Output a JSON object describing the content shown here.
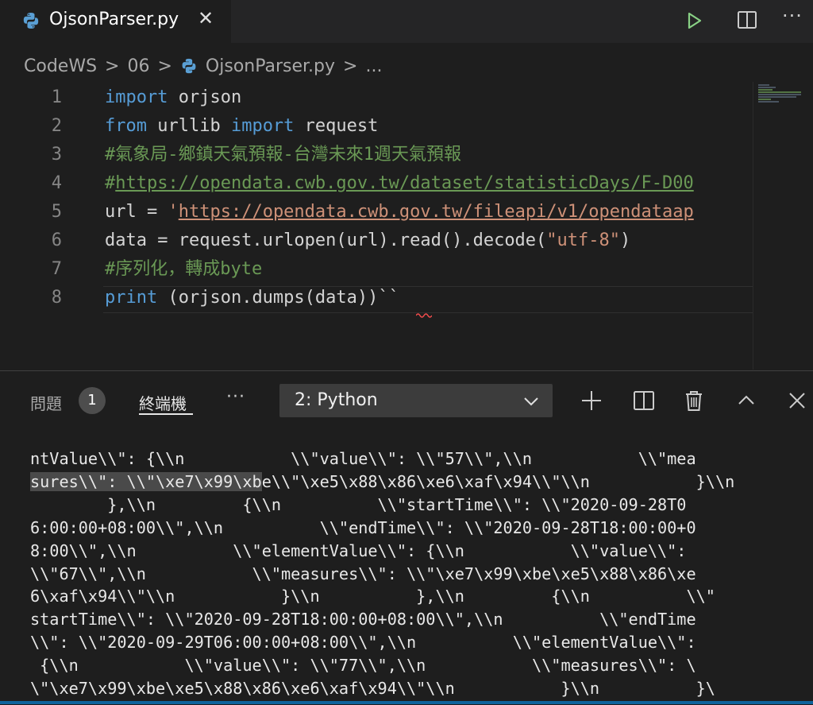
{
  "tab": {
    "title": "OjsonParser.py",
    "close_glyph": "✕",
    "icon": "python-icon"
  },
  "editor_actions": {
    "run_icon": "run-icon",
    "split_icon": "split-editor-icon",
    "more_label": "···"
  },
  "breadcrumb": {
    "items": [
      "CodeWS",
      "06",
      "OjsonParser.py",
      "..."
    ],
    "separator": ">"
  },
  "editor": {
    "line_numbers": [
      "1",
      "2",
      "3",
      "4",
      "5",
      "6",
      "7",
      "8"
    ],
    "lines": {
      "l1": {
        "kw": "import",
        "rest": " orjson"
      },
      "l2": {
        "kw1": "from",
        "mid": " urllib ",
        "kw2": "import",
        "rest": " request"
      },
      "l3": {
        "comment": "#氣象局-鄉鎮天氣預報-台灣未來1週天氣預報"
      },
      "l4": {
        "prefix": "#",
        "url": "https://opendata.cwb.gov.tw/dataset/statisticDays/F-D00"
      },
      "l5": {
        "lead": "url = ",
        "quote": "'",
        "url": "https://opendata.cwb.gov.tw/fileapi/v1/opendataap"
      },
      "l6": {
        "lead": "data = request.urlopen(url).read().decode(",
        "str": "\"utf-8\"",
        "tail": ")"
      },
      "l7": {
        "comment": "#序列化，轉成byte"
      },
      "l8": {
        "kw": "print",
        "rest": " (orjson.dumps(data))``"
      }
    }
  },
  "panel": {
    "problems_label": "問題",
    "problems_count": "1",
    "terminal_label": "終端機",
    "more_label": "···",
    "terminal_select": "2: Python",
    "icons": [
      "plus-icon",
      "split-terminal-icon",
      "trash-icon",
      "chevron-up-icon",
      "close-icon"
    ],
    "terminal_lines": [
      "ntValue\\\\\": {\\\\n           \\\\\"value\\\\\": \\\\\"57\\\\\",\\\\n           \\\\\"mea",
      "\\\\\"\\xe5\\x88\\x86\\xe6\\xaf\\x94\\\\\"\\\\n           }\\\\n",
      "        },\\\\n         {\\\\n          \\\\\"startTime\\\\\": \\\\\"2020-09-28T0",
      "6:00:00+08:00\\\\\",\\\\n          \\\\\"endTime\\\\\": \\\\\"2020-09-28T18:00:00+0",
      "8:00\\\\\",\\\\n          \\\\\"elementValue\\\\\": {\\\\n           \\\\\"value\\\\\":",
      "\\\\\"67\\\\\",\\\\n           \\\\\"measures\\\\\": \\\\\"\\xe7\\x99\\xbe\\xe5\\x88\\x86\\xe",
      "6\\xaf\\x94\\\\\"\\\\n           }\\\\n          },\\\\n         {\\\\n          \\\\\"",
      "startTime\\\\\": \\\\\"2020-09-28T18:00:00+08:00\\\\\",\\\\n          \\\\\"endTime",
      "\\\\\": \\\\\"2020-09-29T06:00:00+08:00\\\\\",\\\\n          \\\\\"elementValue\\\\\":",
      " {\\\\n           \\\\\"value\\\\\": \\\\\"77\\\\\",\\\\n           \\\\\"measures\\\\\": \\",
      "\\\"\\xe7\\x99\\xbe\\xe5\\x88\\x86\\xe6\\xaf\\x94\\\\\"\\\\n           }\\\\n          }\\"
    ],
    "terminal_line2_highlight": "sures\\\\\": \\\\\"\\xe7\\x99\\xb",
    "terminal_line2_after": "e"
  }
}
